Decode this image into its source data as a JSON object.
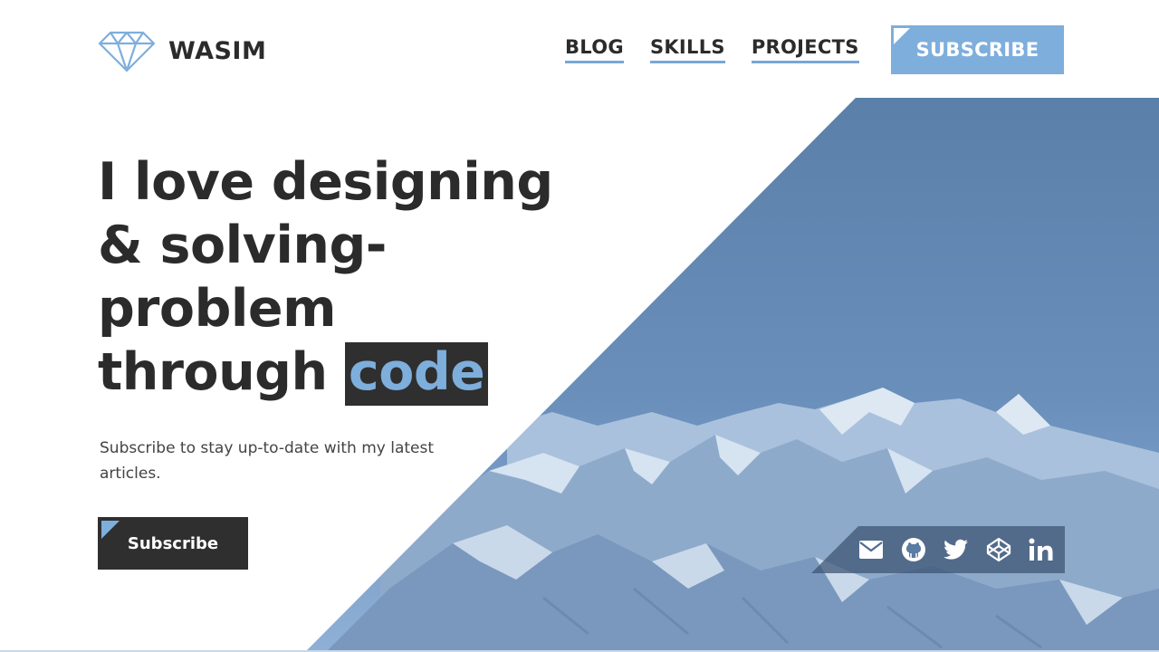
{
  "brand": {
    "name": "WASIM",
    "accent_color": "#7eaedc",
    "dark_color": "#2f2f2f"
  },
  "nav": {
    "links": [
      "BLOG",
      "SKILLS",
      "PROJECTS"
    ],
    "subscribe_label": "SUBSCRIBE"
  },
  "hero": {
    "headline_lines": [
      "I love designing",
      "& solving-",
      "problem",
      "through"
    ],
    "headline_highlight": "code",
    "subtitle": "Subscribe to stay up-to-date with my latest articles.",
    "cta_label": "Subscribe"
  },
  "social": {
    "icons": [
      "mail-icon",
      "github-icon",
      "twitter-icon",
      "codepen-icon",
      "linkedin-icon"
    ]
  }
}
